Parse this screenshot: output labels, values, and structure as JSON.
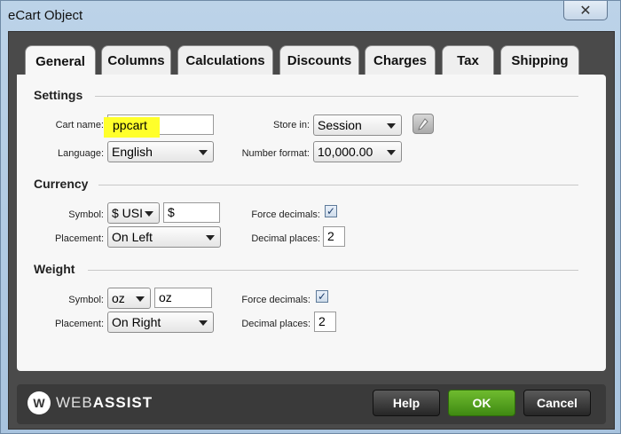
{
  "window": {
    "title": "eCart Object",
    "close_label": "✕"
  },
  "tabs": [
    {
      "label": "General",
      "active": true
    },
    {
      "label": "Columns",
      "active": false
    },
    {
      "label": "Calculations",
      "active": false
    },
    {
      "label": "Discounts",
      "active": false
    },
    {
      "label": "Charges",
      "active": false
    },
    {
      "label": "Tax",
      "active": false
    },
    {
      "label": "Shipping",
      "active": false
    }
  ],
  "settings": {
    "title": "Settings",
    "cart_name_label": "Cart name:",
    "cart_name_value": "ppcart",
    "language_label": "Language:",
    "language_value": "English",
    "store_in_label": "Store in:",
    "store_in_value": "Session",
    "number_format_label": "Number format:",
    "number_format_value": "10,000.00"
  },
  "currency": {
    "title": "Currency",
    "symbol_label": "Symbol:",
    "symbol_select_value": "$ USI",
    "symbol_value": "$",
    "placement_label": "Placement:",
    "placement_value": "On Left",
    "force_decimals_label": "Force decimals:",
    "force_decimals_checked": true,
    "decimal_places_label": "Decimal places:",
    "decimal_places_value": "2"
  },
  "weight": {
    "title": "Weight",
    "symbol_label": "Symbol:",
    "symbol_select_value": "oz",
    "symbol_value": "oz",
    "placement_label": "Placement:",
    "placement_value": "On Right",
    "force_decimals_label": "Force decimals:",
    "force_decimals_checked": true,
    "decimal_places_label": "Decimal places:",
    "decimal_places_value": "2"
  },
  "footer": {
    "logo_light": "WEB",
    "logo_bold": "ASSIST",
    "logo_mark": "W",
    "help_label": "Help",
    "ok_label": "OK",
    "cancel_label": "Cancel"
  },
  "icons": {
    "check": "✓",
    "edit": "pencil-icon"
  },
  "colors": {
    "highlight": "#ffff2a",
    "ok_button": "#4f9a1e",
    "footer": "#3a3a3a"
  }
}
